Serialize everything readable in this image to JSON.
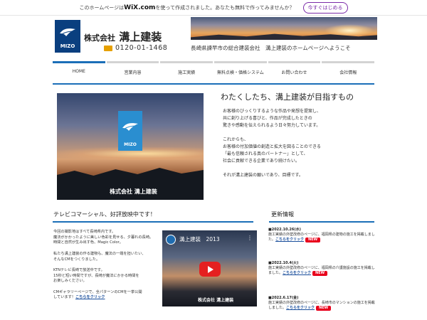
{
  "wix_banner": {
    "message": "このホームページは",
    "logo": "WiX.com",
    "message_after": "を使って作成されました。あなたも無料で作ってみませんか？",
    "button": "今すぐはじめる"
  },
  "header": {
    "logo_text": "MIZO",
    "company_prefix": "株式会社",
    "company_name": "溝上建装",
    "phone": "0120-01-1468",
    "tagline": "長崎県諫早市の総合建装会社　溝上建装のホームページへようこそ"
  },
  "nav": {
    "items": [
      {
        "label": "HOME",
        "active": true
      },
      {
        "label": "営業内容",
        "active": false
      },
      {
        "label": "施工実績",
        "active": false
      },
      {
        "label": "無料点検・価格システム",
        "active": false
      },
      {
        "label": "お問い合わせ",
        "active": false
      },
      {
        "label": "会社情報",
        "active": false
      }
    ]
  },
  "hero": {
    "image_logo_text": "MIZO",
    "image_company": "株式会社 溝上建装",
    "title": "わたくしたち、溝上建装が目指すもの",
    "lines": [
      "お客様のびっくりするような作品や発想を提案し、",
      "共に創り上げる喜びと、作品が完成したときの",
      "驚きや感動を伝えられるよう日々努力しています。",
      "",
      "これからも、",
      "お客様の付加価値の創造と拡大を図ることのできる",
      "「最も信頼される真のパートナー」として、",
      "社会に貢献できる企業であり続けたい。",
      "",
      "それが溝上建装の願いであり、目標です。"
    ]
  },
  "tv": {
    "title": "テレビコマーシャル、好評放映中です！",
    "paragraphs": [
      "今回の撮影地はすべて長崎県内です。",
      "魔法がかかったように美しい色彩を見せる、夕暮れの長崎。",
      "時間と自然が生み出す色、Magic Color。",
      "",
      "私たち溝上建装の作る建物も、魔法の一端を担いたい、",
      "そんなCMをつくりました。",
      "",
      "KTNテレビ長崎で放送中です。",
      "15秒と短い時間ですが、長崎が魔法にかかる時間を",
      "お楽しみください。",
      "",
      "CMギャラリーページで、全パターンのCMを一挙公開",
      "しています！"
    ],
    "link": "こちらをクリック"
  },
  "video": {
    "title": "溝上建装　2013",
    "menu": "⋮",
    "company": "株式会社 溝上建装"
  },
  "news": {
    "title": "更新情報",
    "items": [
      {
        "date": "■2022.10.26(水)",
        "text": "施工実績の外壁改修のページに、福岡県の建物の施工を掲載しました。",
        "link": "こちらをクリック",
        "badge": "NEW"
      },
      {
        "date": "■2022.10.4(火)",
        "text": "施工実績の外壁改修のページに、福岡県の介護施設の施工を掲載しました。",
        "link": "こちらをクリック",
        "badge": "NEW"
      },
      {
        "date": "■2022.6.17(金)",
        "text": "施工実績の外壁改修のページに、長崎市のマンションの施工を掲載しました。",
        "link": "こちらをクリック",
        "badge": "NEW"
      }
    ]
  }
}
